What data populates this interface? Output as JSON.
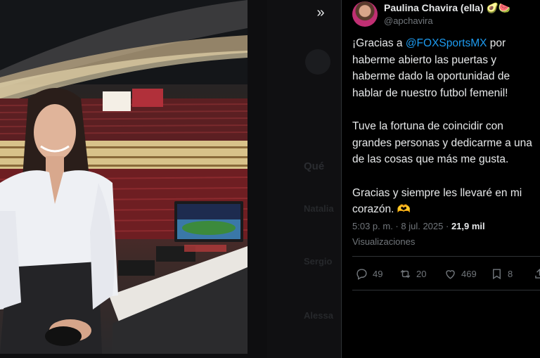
{
  "background_timeline": {
    "ghost_items": [
      "Qué",
      "Natalia",
      "Sergio",
      "Alessa"
    ]
  },
  "media": {
    "description_icon": "stadium-photo"
  },
  "toolbar": {
    "expand_icon": "double-chevron-right-icon"
  },
  "post": {
    "author_name": "Paulina Chavira (ella)",
    "author_emoji": "🥑🍉",
    "author_handle": "@apchavira",
    "text_part1_prefix": "¡Gracias a ",
    "mention": "@FOXSportsMX",
    "text_part1_suffix": " por haberme abierto las puertas y haberme dado la oportunidad de hablar de nuestro futbol femenil!",
    "text_part2": "Tuve la fortuna de coincidir con grandes personas y dedicarme a una de las cosas que más me gusta.",
    "text_part3": "Gracias y siempre les llevaré en mi corazón. 🫶",
    "time": "5:03 p. m.",
    "separator": " · ",
    "date": "8 jul. 2025",
    "views_count": "21,9 mil",
    "views_label": "Visualizaciones",
    "actions": {
      "replies": "49",
      "reposts": "20",
      "likes": "469",
      "bookmarks": "8"
    }
  },
  "colors": {
    "accent": "#1d9bf0",
    "muted": "#71767b",
    "text": "#e7e9ea",
    "border": "#2f3336"
  }
}
